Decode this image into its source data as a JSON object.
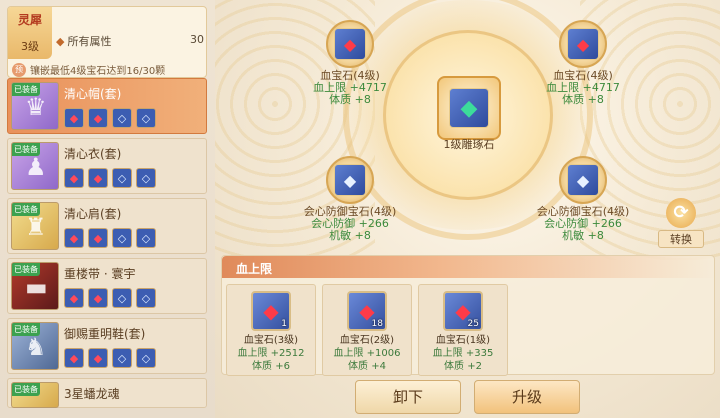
{
  "info": {
    "badge_title": "灵犀",
    "badge_level": "3级",
    "attr_label": "所有属性",
    "attr_value": "30",
    "condition_prefix": "预",
    "condition_text": "镶嵌最低4级宝石达到16/30颗"
  },
  "equip": [
    {
      "name": "清心帽(套)",
      "tag": "已装备",
      "glyph": "♛"
    },
    {
      "name": "清心衣(套)",
      "tag": "已装备",
      "glyph": "♟"
    },
    {
      "name": "清心肩(套)",
      "tag": "已装备",
      "glyph": "♜"
    },
    {
      "name": "重楼带 · 寰宇",
      "tag": "已装备",
      "glyph": "▬"
    },
    {
      "name": "御赐重明鞋(套)",
      "tag": "已装备",
      "glyph": "♞"
    },
    {
      "name": "3星蟠龙魂",
      "tag": "已装备",
      "glyph": "◆"
    }
  ],
  "slots": {
    "top_left": {
      "name": "血宝石(4级)",
      "stat1": "血上限 +4717",
      "stat2": "体质 +8"
    },
    "top_right": {
      "name": "血宝石(4级)",
      "stat1": "血上限 +4717",
      "stat2": "体质 +8"
    },
    "center": {
      "name": "1级雕琢石"
    },
    "bottom_left": {
      "name": "会心防御宝石(4级)",
      "stat1": "会心防御 +266",
      "stat2": "机敏 +8"
    },
    "bottom_right": {
      "name": "会心防御宝石(4级)",
      "stat1": "会心防御 +266",
      "stat2": "机敏 +8"
    }
  },
  "convert_label": "转换",
  "inventory": {
    "tab": "血上限",
    "items": [
      {
        "count": "1",
        "name": "血宝石(3级)",
        "stat1": "血上限 +2512",
        "stat2": "体质 +6"
      },
      {
        "count": "18",
        "name": "血宝石(2级)",
        "stat1": "血上限 +1006",
        "stat2": "体质 +4"
      },
      {
        "count": "25",
        "name": "血宝石(1级)",
        "stat1": "血上限 +335",
        "stat2": "体质 +2"
      }
    ]
  },
  "buttons": {
    "unload": "卸下",
    "upgrade": "升级"
  },
  "icons": {
    "red_gem": "gem-red",
    "white_gem": "gem-white",
    "carving_stone": "gem-green"
  }
}
